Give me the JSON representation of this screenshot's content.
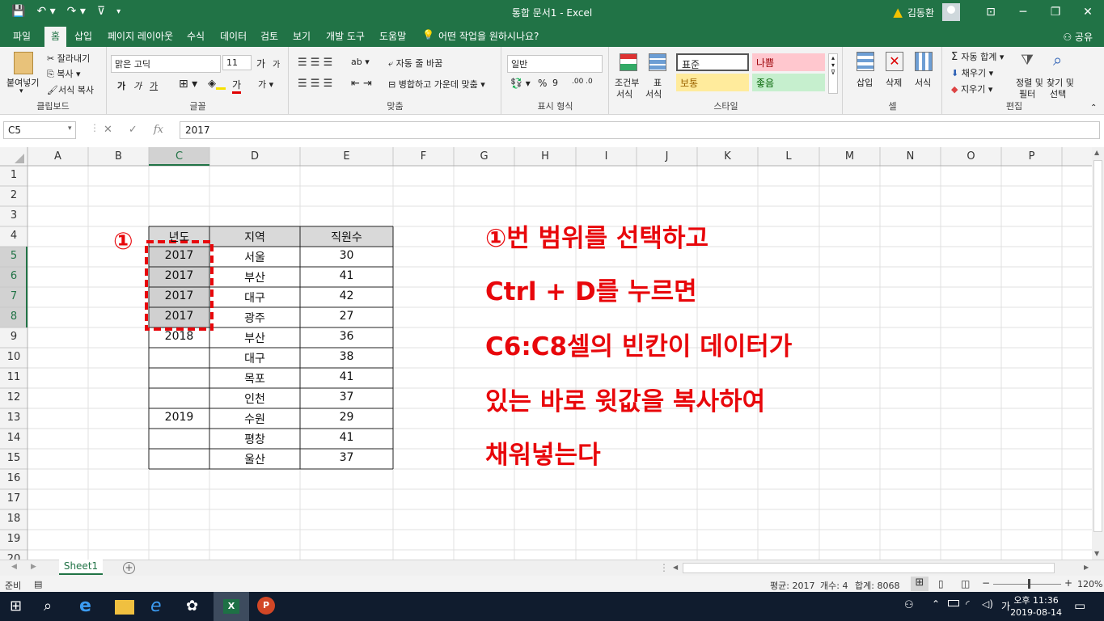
{
  "window": {
    "title": "통합 문서1  -  Excel",
    "user": "김동환",
    "minimize": "─",
    "restore": "❐",
    "close": "✕",
    "ribbon_display": "⊡"
  },
  "qat": {
    "save": "💾",
    "undo": "↶ ▾",
    "redo": "↷ ▾",
    "touch": "⊽",
    "more": "▾"
  },
  "tabs": [
    "파일",
    "홈",
    "삽입",
    "페이지 레이아웃",
    "수식",
    "데이터",
    "검토",
    "보기",
    "개발 도구",
    "도움말",
    "어떤 작업을 원하시나요?"
  ],
  "share": "공유",
  "ribbon": {
    "clipboard": {
      "paste": "붙여넣기",
      "cut": "잘라내기",
      "copy": "복사",
      "format_painter": "서식 복사",
      "label": "클립보드"
    },
    "font": {
      "name": "맑은 고딕",
      "size": "11",
      "grow": "가",
      "shrink": "가",
      "bold": "가",
      "italic": "가",
      "underline": "가",
      "label": "글꼴",
      "color_a": "가"
    },
    "align": {
      "wrap": "자동 줄 바꿈",
      "merge": "병합하고 가운데 맞춤",
      "label": "맞춤"
    },
    "number": {
      "format": "일반",
      "label": "표시 형식",
      "percent": "%"
    },
    "styles": {
      "cond": "조건부",
      "cond2": "서식",
      "table": "표",
      "table2": "서식",
      "normal": "표준",
      "bad": "나쁨",
      "neutral": "보통",
      "good": "좋음",
      "label": "스타일"
    },
    "cells": {
      "insert": "삽입",
      "delete": "삭제",
      "format": "서식",
      "label": "셀"
    },
    "editing": {
      "autosum": "자동 합계",
      "fill": "채우기",
      "clear": "지우기",
      "sort": "정렬 및",
      "sort2": "필터",
      "find": "찾기 및",
      "find2": "선택",
      "label": "편집"
    }
  },
  "formula_bar": {
    "name_box": "C5",
    "content": "2017",
    "fx": "fx"
  },
  "columns": [
    "A",
    "B",
    "C",
    "D",
    "E",
    "F",
    "G",
    "H",
    "I",
    "J",
    "K",
    "L",
    "M",
    "N",
    "O",
    "P"
  ],
  "rows": [
    "1",
    "2",
    "3",
    "4",
    "5",
    "6",
    "7",
    "8",
    "9",
    "10",
    "11",
    "12",
    "13",
    "14",
    "15",
    "16",
    "17",
    "18",
    "19",
    "20"
  ],
  "table": {
    "headers": [
      "년도",
      "지역",
      "직원수"
    ],
    "rows": [
      [
        "2017",
        "서울",
        "30"
      ],
      [
        "2017",
        "부산",
        "41"
      ],
      [
        "2017",
        "대구",
        "42"
      ],
      [
        "2017",
        "광주",
        "27"
      ],
      [
        "2018",
        "부산",
        "36"
      ],
      [
        "",
        "대구",
        "38"
      ],
      [
        "",
        "목포",
        "41"
      ],
      [
        "",
        "인천",
        "37"
      ],
      [
        "2019",
        "수원",
        "29"
      ],
      [
        "",
        "평창",
        "41"
      ],
      [
        "",
        "울산",
        "37"
      ]
    ]
  },
  "marker": "①",
  "annotation": [
    "①번 범위를 선택하고",
    "Ctrl + D를 누르면",
    "C6:C8셀의 빈칸이 데이터가",
    "있는 바로 윗값을 복사하여",
    "채워넣는다"
  ],
  "sheet": {
    "tab": "Sheet1",
    "add": "+"
  },
  "status": {
    "ready": "준비",
    "average": "평균: 2017",
    "count": "개수: 4",
    "sum": "합계: 8068",
    "zoom": "120%",
    "minus": "−",
    "plus": "+"
  },
  "taskbar": {
    "time": "오후 11:36",
    "date": "2019-08-14",
    "ime": "가"
  }
}
